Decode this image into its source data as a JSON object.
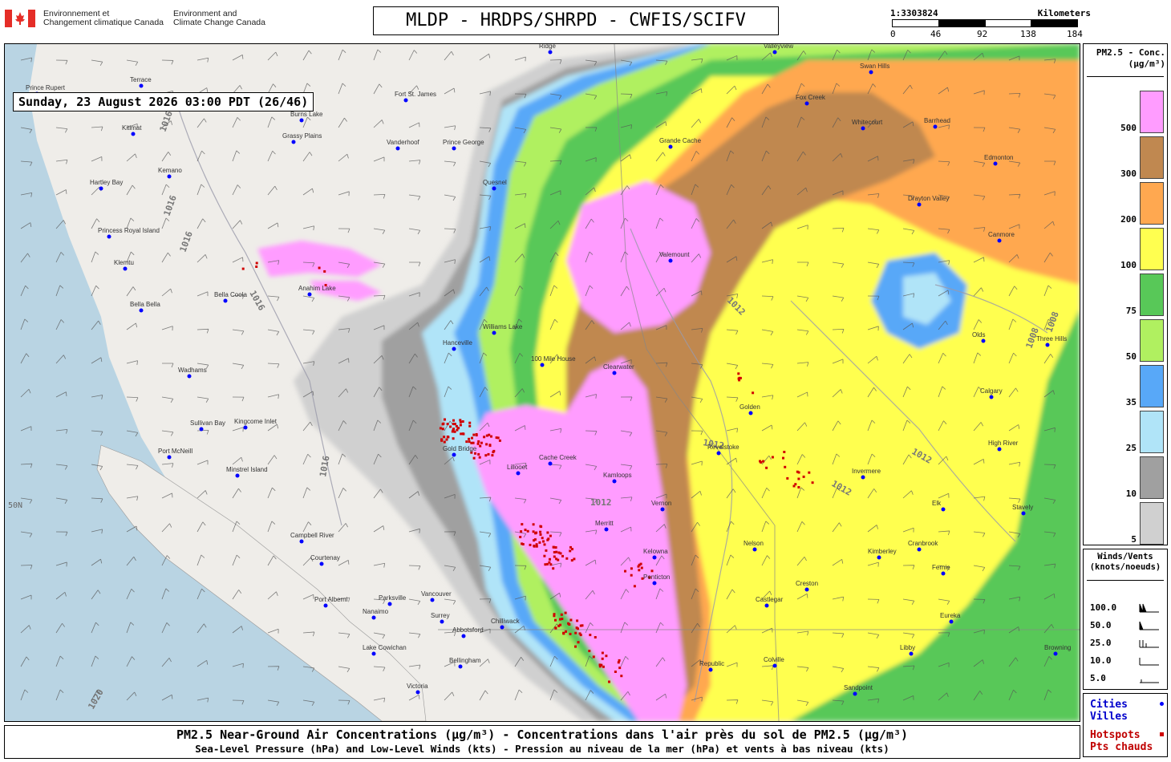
{
  "header": {
    "gov_fr": "Environnement et\nChangement climatique Canada",
    "gov_en": "Environment and\nClimate Change Canada",
    "product_title": "MLDP - HRDPS/SHRPD - CWFIS/SCIFV"
  },
  "scale": {
    "ratio": "1:3303824",
    "unit": "Kilometers",
    "ticks": [
      "0",
      "46",
      "92",
      "138",
      "184"
    ]
  },
  "timestamp": "Sunday, 23 August 2026 03:00 PDT (26/46)",
  "legend_concentration": {
    "title": "PM2.5 - Conc.\n(µg/m³)",
    "bins": [
      {
        "label": "500",
        "color": "#ff9cff"
      },
      {
        "label": "300",
        "color": "#c08850"
      },
      {
        "label": "200",
        "color": "#ffa850"
      },
      {
        "label": "100",
        "color": "#ffff50"
      },
      {
        "label": "75",
        "color": "#58c858"
      },
      {
        "label": "50",
        "color": "#b0f060"
      },
      {
        "label": "35",
        "color": "#58a8f8"
      },
      {
        "label": "25",
        "color": "#b0e4f8"
      },
      {
        "label": "10",
        "color": "#a0a0a0"
      },
      {
        "label": "5",
        "color": "#d0d0d0"
      }
    ]
  },
  "legend_winds": {
    "title": "Winds/Vents\n(knots/noeuds)",
    "rows": [
      "100.0",
      "50.0",
      "25.0",
      "10.0",
      "5.0"
    ]
  },
  "legend_markers": {
    "cities": "Cities\nVilles",
    "hotspots": "Hotspots\nPts chauds"
  },
  "caption": {
    "line1": "PM2.5 Near-Ground Air Concentrations (µg/m³) - Concentrations dans l'air près du sol de PM2.5 (µg/m³)",
    "line2": "Sea-Level Pressure (hPa) and Low-Level Winds (kts) - Pression au niveau de la mer (hPa) et vents à bas niveau (kts)"
  },
  "map": {
    "lat_label": "50N",
    "isobar_labels": [
      "1016",
      "1016",
      "1016",
      "1016",
      "1016",
      "1012",
      "1012",
      "1012",
      "1012",
      "1012",
      "1008",
      "1008",
      "1020"
    ],
    "place_labels": [
      "Terrace",
      "Kitimat",
      "Prince Rupert",
      "Hartley Bay",
      "Kemano",
      "Princess Royal Island",
      "Klemtu",
      "Bella Bella",
      "Bella Coola",
      "Anahim Lake",
      "Wadhams",
      "Sullivan Bay",
      "Kingcome Inlet",
      "Port McNeill",
      "Minstrel Island",
      "Campbell River",
      "Courtenay",
      "Port Alberni",
      "Parksville",
      "Nanaimo",
      "Lake Cowichan",
      "Victoria",
      "Vancouver",
      "Surrey",
      "Abbotsford",
      "Chilliwack",
      "Bellingham",
      "Hanceville",
      "Williams Lake",
      "100 Mile House",
      "Clearwater",
      "Kamloops",
      "Cache Creek",
      "Gold Bridge",
      "Lillooet",
      "Merritt",
      "Kelowna",
      "Penticton",
      "Vernon",
      "Valemount",
      "Grande Cache",
      "Fox Creek",
      "Whitecourt",
      "Barrhead",
      "Edmonton",
      "Drayton Valley",
      "Swan Hills",
      "Valleyview",
      "Calgary",
      "High River",
      "Olds",
      "Three Hills",
      "Invermere",
      "Kimberley",
      "Fernie",
      "Eureka",
      "Libby",
      "Sandpoint",
      "Republic",
      "Colville",
      "Castlegar",
      "Nelson",
      "Revelstoke",
      "Golden",
      "Canmore",
      "Stavely",
      "Elk",
      "Cranbrook",
      "Creston",
      "Fort St. James",
      "Vanderhoof",
      "Burns Lake",
      "Grassy Plains",
      "Prince George",
      "Quesnel",
      "Ridge",
      "Browning"
    ]
  }
}
